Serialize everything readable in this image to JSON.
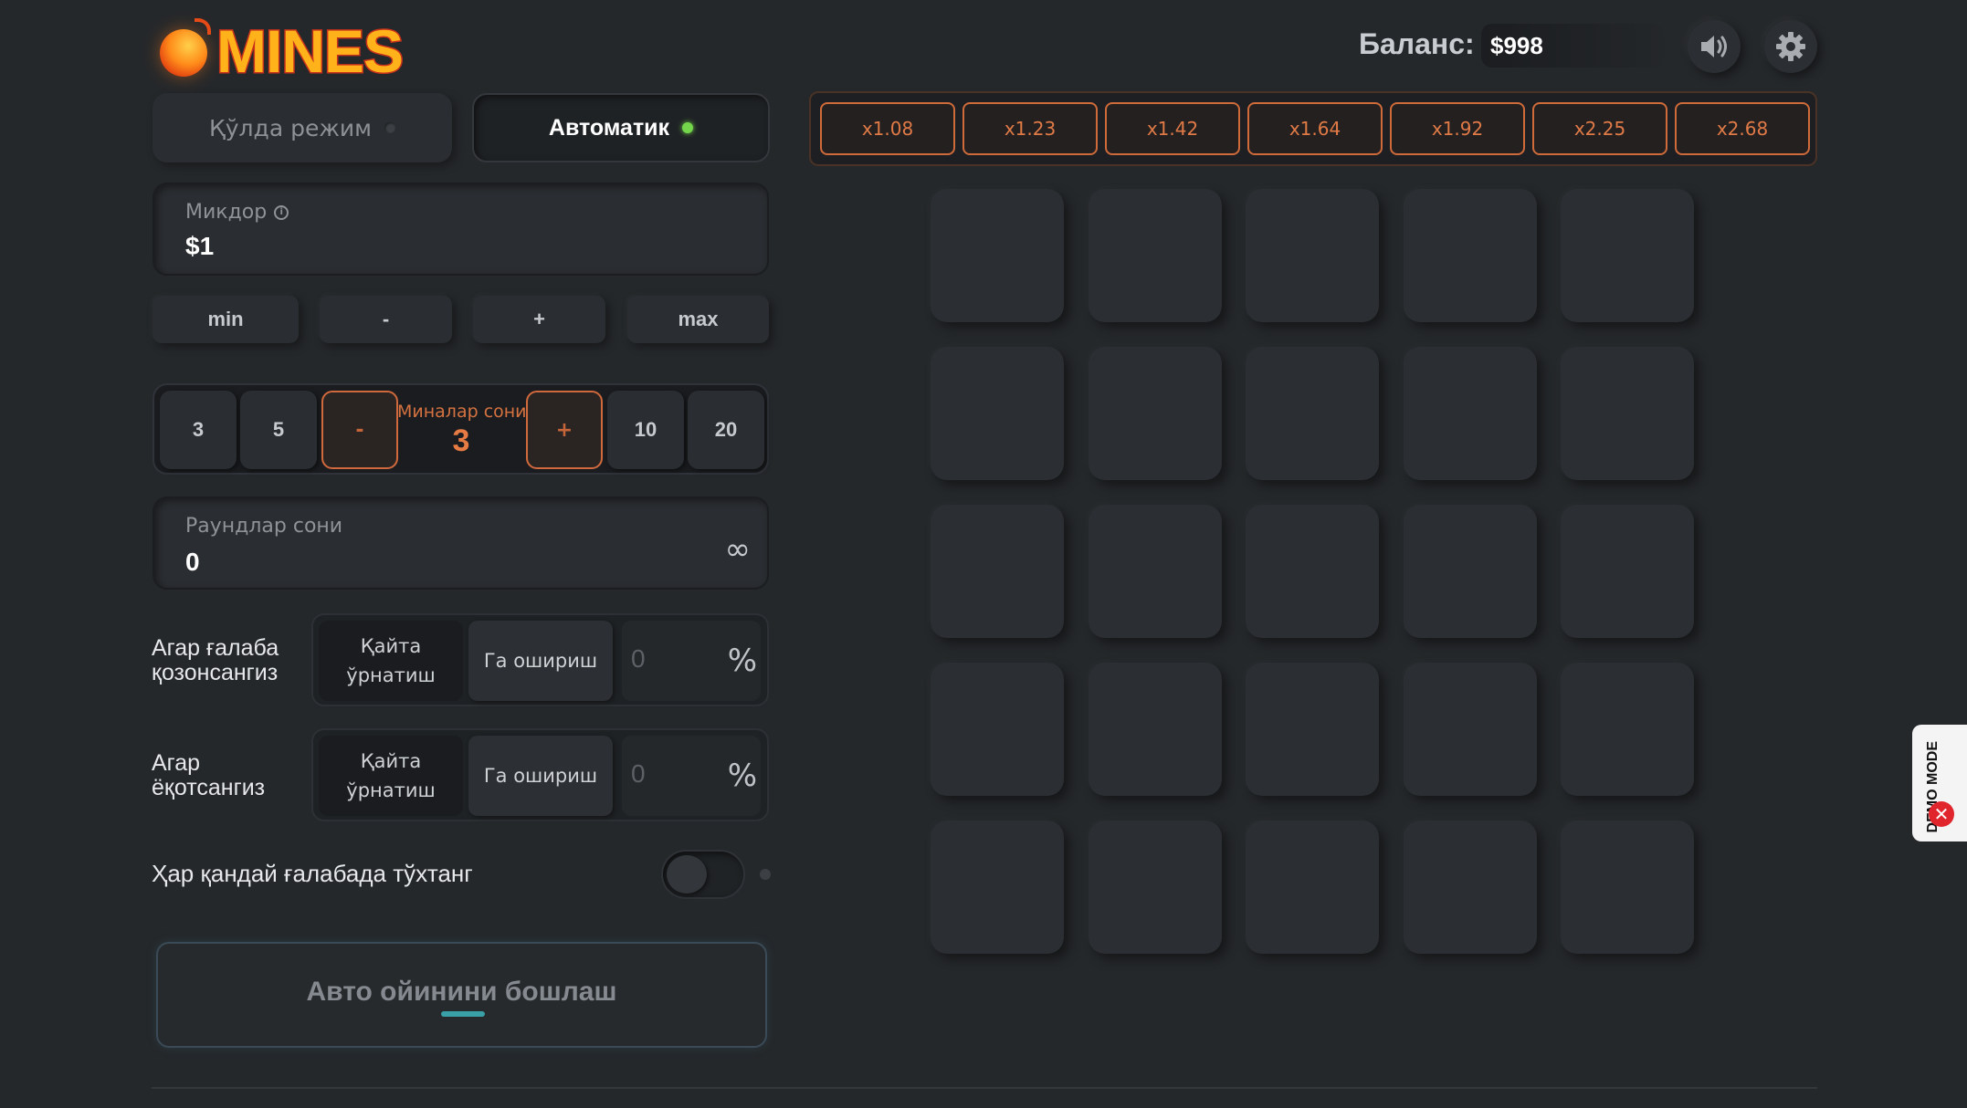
{
  "app": {
    "logo_text": "MINES"
  },
  "header": {
    "balance_label": "Баланс:",
    "balance_value": "$998",
    "sound_icon": "speaker-icon",
    "settings_icon": "gear-icon"
  },
  "tabs": {
    "manual": "Қўлда режим",
    "auto": "Автоматик",
    "active": "auto"
  },
  "amount": {
    "label": "Микдор",
    "value": "$1",
    "buttons": [
      "min",
      "-",
      "+",
      "max"
    ]
  },
  "mines": {
    "options_left": [
      "3",
      "5"
    ],
    "minus": "-",
    "label": "Миналар сони",
    "value": "3",
    "plus": "+",
    "options_right": [
      "10",
      "20"
    ]
  },
  "rounds": {
    "label": "Раундлар сони",
    "value": "0",
    "infinity": "∞"
  },
  "on_win": {
    "label": "Агар ғалаба қозонсангиз",
    "reset": "Қайта ўрнатиш",
    "increase": "Га ошириш",
    "value": "0",
    "percent": "%"
  },
  "on_loss": {
    "label": "Агар ёқотсангиз",
    "reset": "Қайта ўрнатиш",
    "increase": "Га ошириш",
    "value": "0",
    "percent": "%"
  },
  "stop_on_win": {
    "label": "Ҳар қандай ғалабада тўхтанг",
    "enabled": false
  },
  "start_button": "Авто ойинини бошлаш",
  "multipliers": [
    "x1.08",
    "x1.23",
    "x1.42",
    "x1.64",
    "x1.92",
    "x2.25",
    "x2.68"
  ],
  "grid": {
    "rows": 5,
    "cols": 5
  },
  "demo_badge": {
    "text": "DEMO MODE",
    "close": "✕"
  },
  "colors": {
    "background": "#25282b",
    "accent_orange": "#e07a47",
    "active_dot": "#74d64a",
    "start_underline": "#3aa0a8"
  }
}
